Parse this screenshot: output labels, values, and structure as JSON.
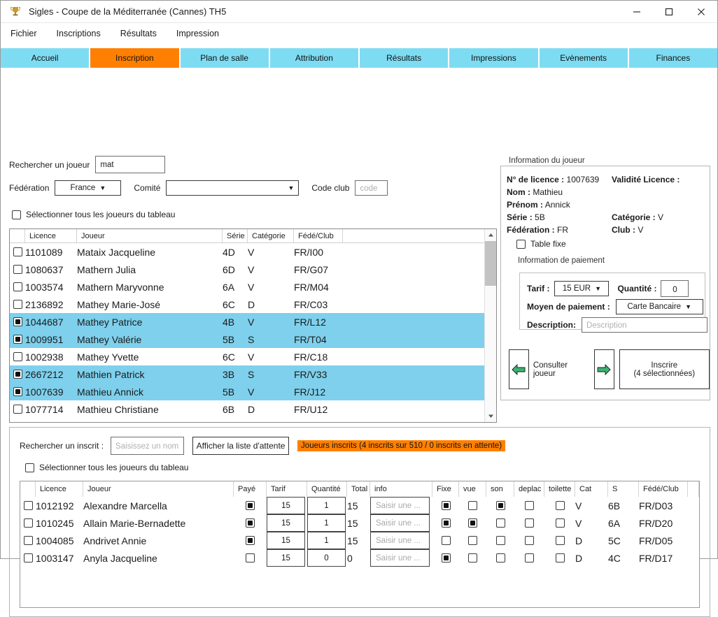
{
  "window": {
    "title": "Sigles - Coupe de la Méditerranée (Cannes) TH5",
    "app_icon": "trophy-icon",
    "minimize": "–",
    "maximize": "□",
    "close": "✕"
  },
  "menubar": {
    "items": [
      "Fichier",
      "Inscriptions",
      "Résultats",
      "Impression"
    ]
  },
  "tabs": {
    "active": "Inscription",
    "accent": "#ff8000",
    "base": "#7edcf2",
    "items": [
      "Accueil",
      "Inscription",
      "Plan de salle",
      "Attribution",
      "Résultats",
      "Impressions",
      "Evènements",
      "Finances"
    ]
  },
  "search": {
    "player_label": "Rechercher un joueur",
    "player_value": "mat",
    "federation_label": "Fédération",
    "federation_value": "France",
    "comite_label": "Comité",
    "comite_value": "",
    "code_club_label": "Code club",
    "code_club_placeholder": "code",
    "select_all_label": "Sélectionner tous les joueurs du tableau",
    "select_all_checked": false
  },
  "player_table": {
    "columns": [
      "Licence",
      "Joueur",
      "Série",
      "Catégorie",
      "Fédé/Club"
    ],
    "rows": [
      {
        "checked": false,
        "licence": "1101089",
        "joueur": "Mataix Jacqueline",
        "serie": "4D",
        "categorie": "V",
        "fede": "FR/I00",
        "selected": false
      },
      {
        "checked": false,
        "licence": "1080637",
        "joueur": "Mathern Julia",
        "serie": "6D",
        "categorie": "V",
        "fede": "FR/G07",
        "selected": false
      },
      {
        "checked": false,
        "licence": "1003574",
        "joueur": "Mathern Maryvonne",
        "serie": "6A",
        "categorie": "V",
        "fede": "FR/M04",
        "selected": false
      },
      {
        "checked": false,
        "licence": "2136892",
        "joueur": "Mathey Marie-José",
        "serie": "6C",
        "categorie": "D",
        "fede": "FR/C03",
        "selected": false
      },
      {
        "checked": true,
        "licence": "1044687",
        "joueur": "Mathey Patrice",
        "serie": "4B",
        "categorie": "V",
        "fede": "FR/L12",
        "selected": true
      },
      {
        "checked": true,
        "licence": "1009951",
        "joueur": "Mathey Valérie",
        "serie": "5B",
        "categorie": "S",
        "fede": "FR/T04",
        "selected": true
      },
      {
        "checked": false,
        "licence": "1002938",
        "joueur": "Mathey Yvette",
        "serie": "6C",
        "categorie": "V",
        "fede": "FR/C18",
        "selected": false
      },
      {
        "checked": true,
        "licence": "2667212",
        "joueur": "Mathien Patrick",
        "serie": "3B",
        "categorie": "S",
        "fede": "FR/V33",
        "selected": true
      },
      {
        "checked": true,
        "licence": "1007639",
        "joueur": "Mathieu Annick",
        "serie": "5B",
        "categorie": "V",
        "fede": "FR/J12",
        "selected": true
      },
      {
        "checked": false,
        "licence": "1077714",
        "joueur": "Mathieu Christiane",
        "serie": "6B",
        "categorie": "D",
        "fede": "FR/U12",
        "selected": false
      }
    ],
    "scrollbar": {
      "up": "⌃",
      "down": "⌄"
    }
  },
  "player_info": {
    "group_label": "Information du joueur",
    "licence_key": "N° de licence :",
    "licence_value": "1007639",
    "validity_key": "Validité Licence :",
    "validity_value": "",
    "nom_key": "Nom :",
    "nom_value": "Mathieu",
    "prenom_key": "Prénom :",
    "prenom_value": "Annick",
    "serie_key": "Série :",
    "serie_value": "5B",
    "categorie_key": "Catégorie :",
    "categorie_value": "V",
    "federation_key": "Fédération :",
    "federation_value": "FR",
    "club_key": "Club :",
    "club_value": "V",
    "table_fixe_label": "Table fixe",
    "table_fixe_checked": false
  },
  "payment": {
    "group_label": "Information de paiement",
    "tarif_label": "Tarif :",
    "tarif_value": "15 EUR",
    "quantite_label": "Quantité :",
    "quantite_value": "0",
    "moyen_label": "Moyen de paiement :",
    "moyen_value": "Carte Bancaire",
    "description_label": "Description:",
    "description_placeholder": "Description"
  },
  "actions": {
    "back_arrow": "left-arrow-icon",
    "consulter_label": "Consulter joueur",
    "forward_arrow": "right-arrow-icon",
    "inscrire_line1": "Inscrire",
    "inscrire_line2": "(4 sélectionnées)",
    "arrow_color": "#3cb371"
  },
  "registered": {
    "search_label": "Rechercher un inscrit :",
    "search_placeholder": "Saisissez un nom",
    "waitlist_button": "Afficher la liste d'attente",
    "status_badge": "Joueurs inscrits (4 inscrits sur 510 / 0 inscrits en attente)",
    "status_color": "#ff8000",
    "select_all_label": "Sélectionner tous les joueurs du tableau",
    "select_all_checked": false,
    "columns": [
      "Licence",
      "Joueur",
      "Payé",
      "Tarif",
      "Quantité",
      "Total",
      "info",
      "Fixe",
      "vue",
      "son",
      "deplac",
      "toilette",
      "Cat",
      "S",
      "Fédé/Club"
    ],
    "info_placeholder": "Saisir une ...",
    "rows": [
      {
        "checked": false,
        "licence": "1012192",
        "joueur": "Alexandre Marcella",
        "paye": true,
        "tarif": "15",
        "quantite": "1",
        "total": "15",
        "fixe": true,
        "vue": false,
        "son": true,
        "deplac": false,
        "toilette": false,
        "cat": "V",
        "s": "6B",
        "fede": "FR/D03"
      },
      {
        "checked": false,
        "licence": "1010245",
        "joueur": "Allain Marie-Bernadette",
        "paye": true,
        "tarif": "15",
        "quantite": "1",
        "total": "15",
        "fixe": true,
        "vue": true,
        "son": false,
        "deplac": false,
        "toilette": false,
        "cat": "V",
        "s": "6A",
        "fede": "FR/D20"
      },
      {
        "checked": false,
        "licence": "1004085",
        "joueur": "Andrivet Annie",
        "paye": true,
        "tarif": "15",
        "quantite": "1",
        "total": "15",
        "fixe": false,
        "vue": false,
        "son": false,
        "deplac": false,
        "toilette": false,
        "cat": "D",
        "s": "5C",
        "fede": "FR/D05"
      },
      {
        "checked": false,
        "licence": "1003147",
        "joueur": "Anyla Jacqueline",
        "paye": false,
        "tarif": "15",
        "quantite": "0",
        "total": "0",
        "fixe": true,
        "vue": false,
        "son": false,
        "deplac": false,
        "toilette": false,
        "cat": "D",
        "s": "4C",
        "fede": "FR/D17"
      }
    ]
  }
}
